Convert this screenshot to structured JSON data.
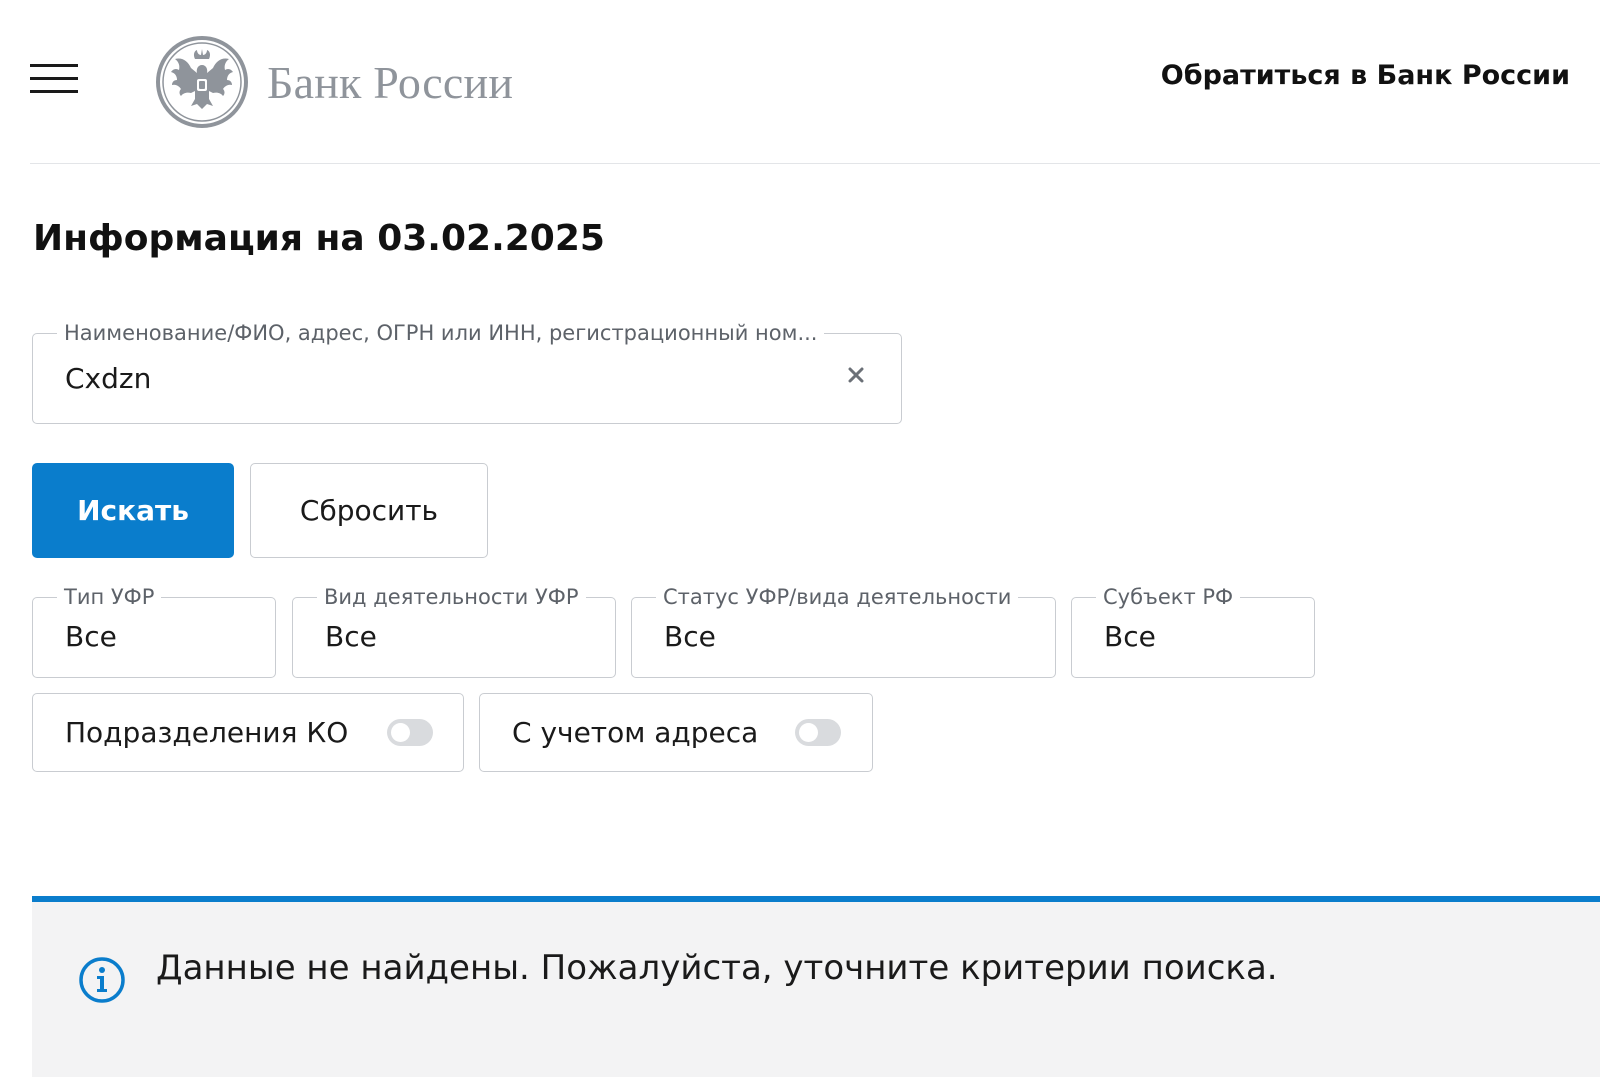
{
  "header": {
    "logo_text": "Банк России",
    "contact_link": "Обратиться в Банк России"
  },
  "page_title": "Информация на 03.02.2025",
  "search": {
    "legend": "Наименование/ФИО, адрес, ОГРН или ИНН, регистрационный ном...",
    "value": "Cxdzn"
  },
  "buttons": {
    "search_label": "Искать",
    "reset_label": "Сбросить"
  },
  "filters": [
    {
      "legend": "Тип УФР",
      "value": "Все"
    },
    {
      "legend": "Вид деятельности УФР",
      "value": "Все"
    },
    {
      "legend": "Статус УФР/вида деятельности",
      "value": "Все"
    },
    {
      "legend": "Субъект РФ",
      "value": "Все"
    }
  ],
  "toggles": [
    {
      "label": "Подразделения КО",
      "on": false
    },
    {
      "label": "С учетом адреса",
      "on": false
    }
  ],
  "notice": {
    "text": "Данные не найдены. Пожалуйста, уточните критерии поиска."
  },
  "colors": {
    "accent": "#0a7dcc",
    "logo_gray": "#8f949b",
    "border": "#c9ccd1",
    "notice_bg": "#f3f3f4"
  },
  "icons": {
    "menu": "hamburger-icon",
    "logo": "double-headed-eagle-emblem",
    "clear": "close-icon",
    "info": "info-icon"
  }
}
